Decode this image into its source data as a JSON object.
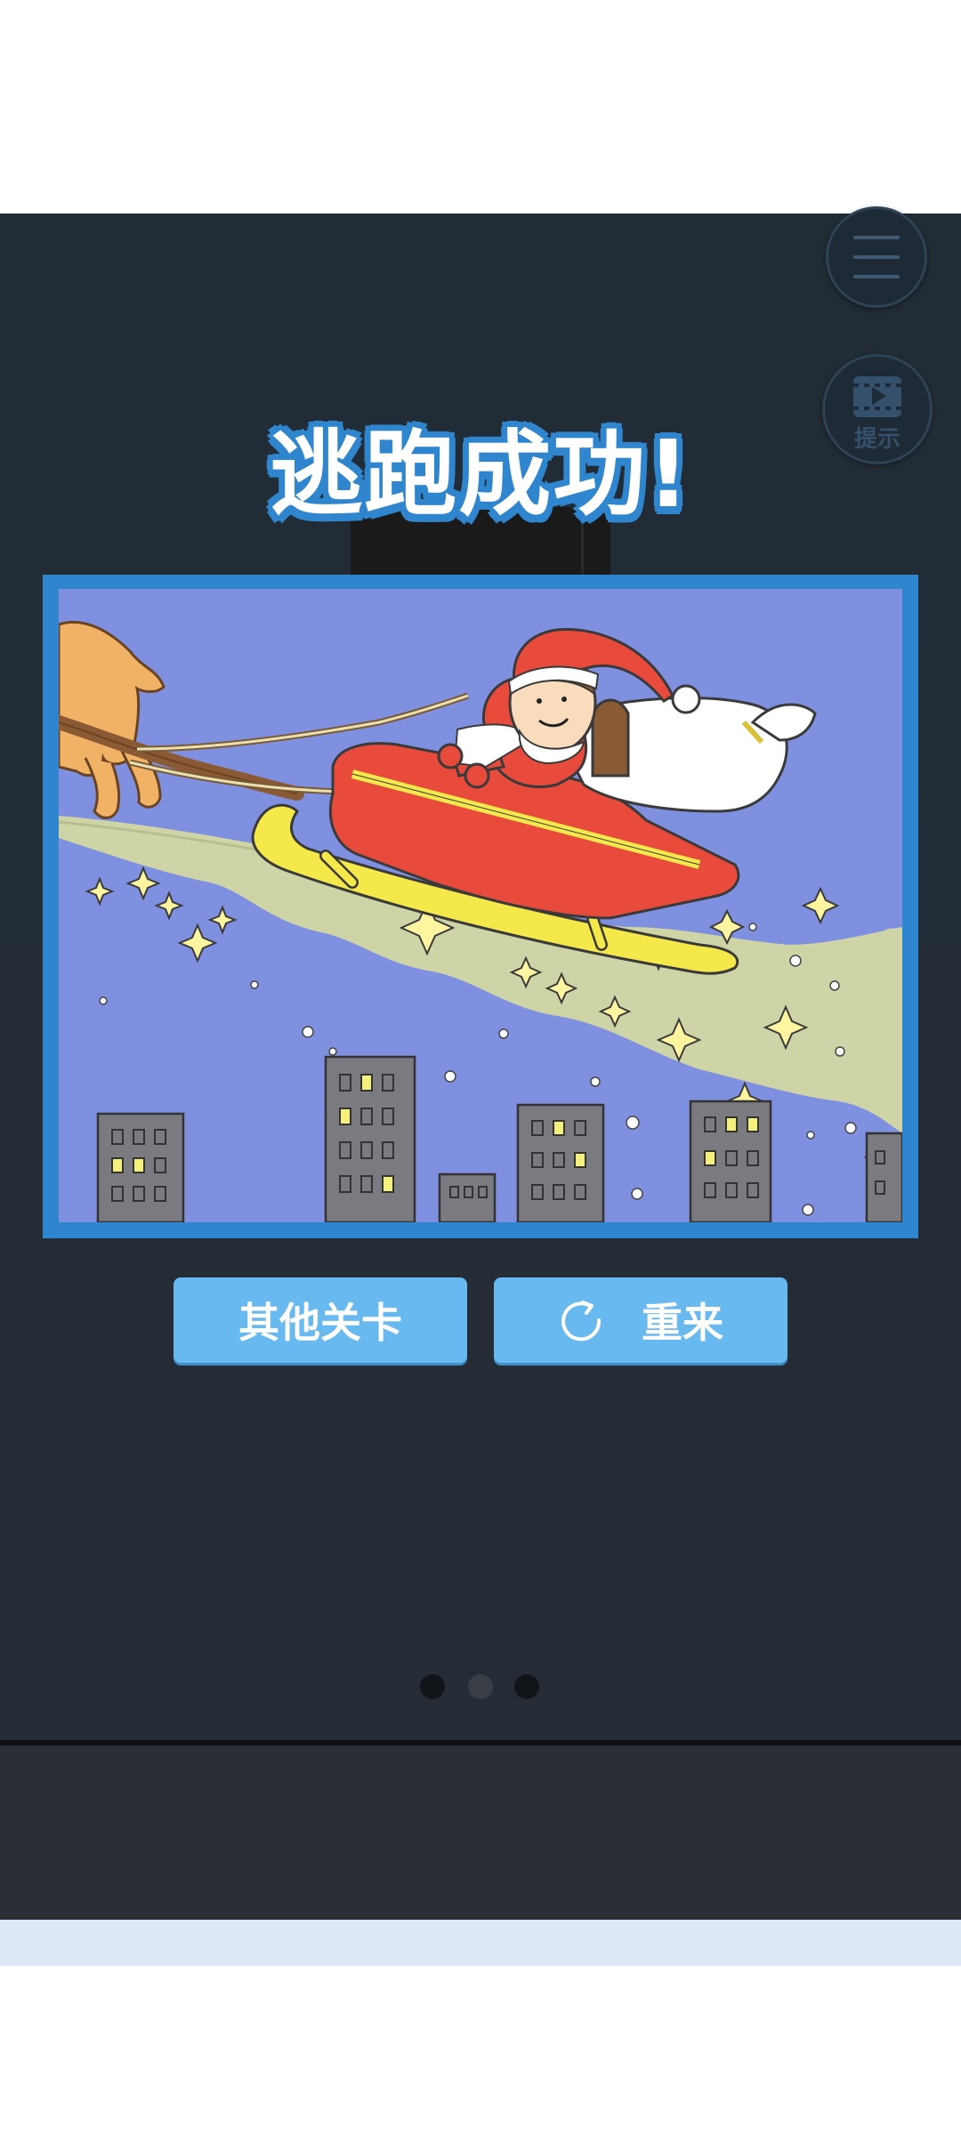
{
  "screen": {
    "title": "逃跑成功!",
    "hint_label": "提示",
    "buttons": {
      "other_levels": "其他关卡",
      "retry": "重来"
    },
    "page_indicator": {
      "count": 3,
      "active_index": 1
    }
  },
  "icons": {
    "menu": "hamburger-menu-icon",
    "hint": "video-film-icon",
    "retry": "refresh-circular-arrow-icon"
  },
  "colors": {
    "background_dark": "#232d37",
    "title_outline": "#2f86cf",
    "button_blue": "#68b9ef",
    "frame_blue": "#2f86cf",
    "sky": "#8090e0"
  }
}
